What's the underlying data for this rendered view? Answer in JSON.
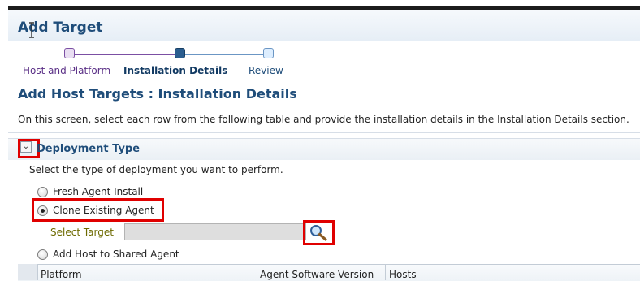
{
  "page": {
    "title": "Add Target"
  },
  "train": {
    "steps": [
      {
        "label": "Host and Platform",
        "state": "done"
      },
      {
        "label": "Installation Details",
        "state": "current"
      },
      {
        "label": "Review",
        "state": "next"
      }
    ]
  },
  "section": {
    "title": "Add Host Targets : Installation Details",
    "intro": "On this screen, select each row from the following table and provide the installation details in the Installation Details section."
  },
  "deployment": {
    "title": "Deployment Type",
    "description": "Select the type of deployment you want to perform.",
    "options": [
      {
        "label": "Fresh Agent Install",
        "selected": false
      },
      {
        "label": "Clone Existing Agent",
        "selected": true
      },
      {
        "label": "Add Host to Shared Agent",
        "selected": false
      }
    ],
    "select_target_label": "Select Target",
    "select_target_value": ""
  },
  "table": {
    "columns": [
      "Platform",
      "Agent Software Version",
      "Hosts"
    ]
  },
  "colors": {
    "title_blue": "#1f4d7a",
    "highlight_red": "#e00000",
    "train_purple": "#7b4fa3",
    "train_current": "#2a5d8f"
  },
  "icons": {
    "collapse": "chevron-down-icon",
    "search": "magnifier-icon",
    "cursor": "text-cursor-icon"
  }
}
